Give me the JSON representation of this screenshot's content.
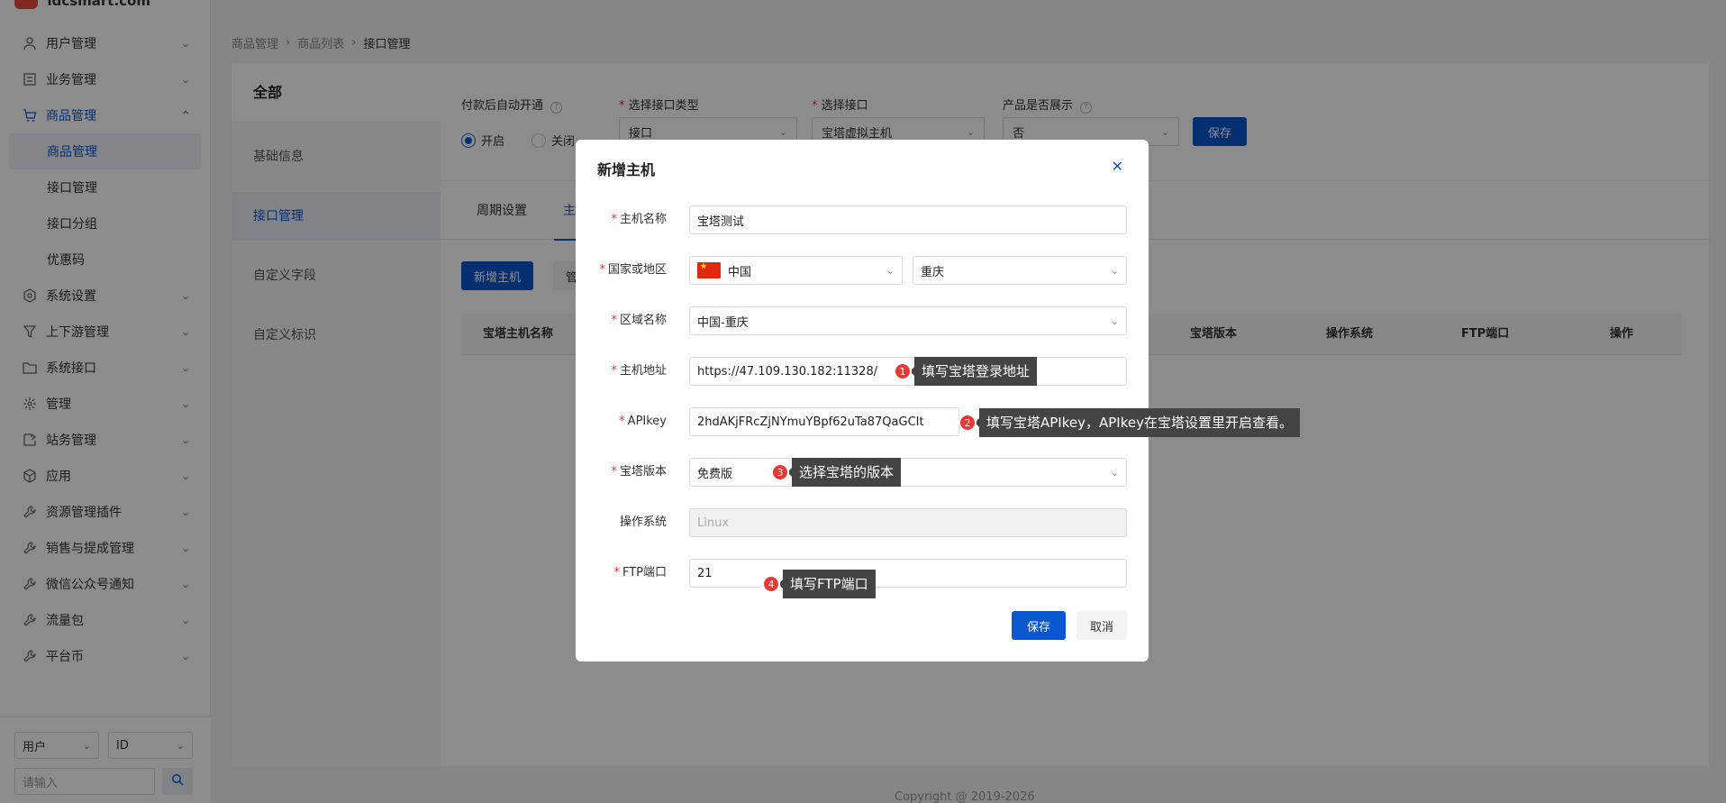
{
  "logo": {
    "text": "idcsmart.com"
  },
  "sidebar": {
    "items": [
      {
        "label": "用户管理",
        "icon": "user-icon"
      },
      {
        "label": "业务管理",
        "icon": "list-icon"
      },
      {
        "label": "商品管理",
        "icon": "cart-icon",
        "expanded": true,
        "children": [
          {
            "label": "商品管理",
            "selected": true
          },
          {
            "label": "接口管理"
          },
          {
            "label": "接口分组"
          },
          {
            "label": "优惠码"
          }
        ]
      },
      {
        "label": "系统设置",
        "icon": "settings-icon"
      },
      {
        "label": "上下游管理",
        "icon": "filter-icon"
      },
      {
        "label": "系统接口",
        "icon": "folder-icon"
      },
      {
        "label": "管理",
        "icon": "sun-icon"
      },
      {
        "label": "站务管理",
        "icon": "share-icon"
      },
      {
        "label": "应用",
        "icon": "cube-icon"
      },
      {
        "label": "资源管理插件",
        "icon": "wrench-icon"
      },
      {
        "label": "销售与提成管理",
        "icon": "wrench-icon"
      },
      {
        "label": "微信公众号通知",
        "icon": "wrench-icon"
      },
      {
        "label": "流量包",
        "icon": "wrench-icon"
      },
      {
        "label": "平台币",
        "icon": "wrench-icon"
      }
    ],
    "bottom": {
      "type_select": "用户",
      "field_select": "ID",
      "search_placeholder": "请输入"
    }
  },
  "breadcrumb": [
    "商品管理",
    "商品列表",
    "接口管理"
  ],
  "left_nav": {
    "title": "全部",
    "items": [
      "基础信息",
      "接口管理",
      "自定义字段",
      "自定义标识"
    ]
  },
  "config": {
    "auto_open_label": "付款后自动开通",
    "radio_on": "开启",
    "radio_off": "关闭",
    "interface_type_label": "选择接口类型",
    "interface_type_value": "接口",
    "interface_label": "选择接口",
    "interface_value": "宝塔虚拟主机",
    "show_label": "产品是否展示",
    "show_value": "否",
    "save": "保存"
  },
  "tabs": [
    "周期设置",
    "主机"
  ],
  "toolbar": {
    "add_host": "新增主机",
    "manage": "管"
  },
  "table": {
    "headers": [
      "宝塔主机名称",
      "宝塔版本",
      "操作系统",
      "FTP端口",
      "操作"
    ]
  },
  "copyright": "Copyright @ 2019-2026",
  "modal": {
    "title": "新增主机",
    "fields": {
      "host_name": {
        "label": "主机名称",
        "value": "宝塔测试"
      },
      "region": {
        "label": "国家或地区",
        "country": "中国",
        "city": "重庆"
      },
      "area_name": {
        "label": "区域名称",
        "value": "中国-重庆"
      },
      "host_address": {
        "label": "主机地址",
        "value": "https://47.109.130.182:11328/"
      },
      "apikey": {
        "label": "APIkey",
        "value": "2hdAKjFRcZjNYmuYBpf62uTa87QaGCIt"
      },
      "bt_version": {
        "label": "宝塔版本",
        "value": "免费版"
      },
      "os": {
        "label": "操作系统",
        "placeholder": "Linux"
      },
      "ftp_port": {
        "label": "FTP端口",
        "value": "21"
      }
    },
    "save": "保存",
    "cancel": "取消"
  },
  "tips": [
    {
      "num": "1",
      "text": "填写宝塔登录地址"
    },
    {
      "num": "2",
      "text": "填写宝塔APIkey，APIkey在宝塔设置里开启查看。"
    },
    {
      "num": "3",
      "text": "选择宝塔的版本"
    },
    {
      "num": "4",
      "text": "填写FTP端口"
    }
  ]
}
